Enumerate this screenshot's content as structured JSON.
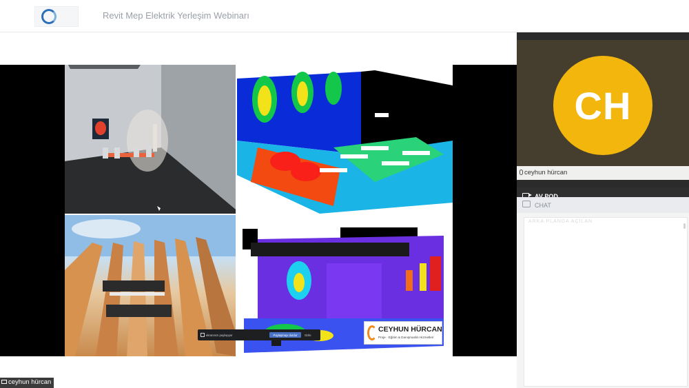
{
  "header": {
    "title": "Revit Mep Elektrik Yerleşim Webinarı",
    "logo_icon": "organization-logo"
  },
  "share": {
    "presenter_label": "ceyhun hürcan",
    "watermark_line1": "CEYHUN HÜRCAN",
    "watermark_line2": "Proje · Eğitim & Danışmanlık Hizmetleri",
    "share_notice": "ekranınızı paylaşıyor",
    "share_stop_label": "Paylaşmayı durdur",
    "share_hide_label": "Gizle"
  },
  "video_pod": {
    "initials": "CH",
    "avatar_color": "#F2B60D",
    "participant_name": "ceyhun hürcan"
  },
  "pods": {
    "av_pod_label": "AV POD",
    "chat_label": "CHAT",
    "chat_faint_text": "ARKA PLANDA AÇILAN"
  }
}
